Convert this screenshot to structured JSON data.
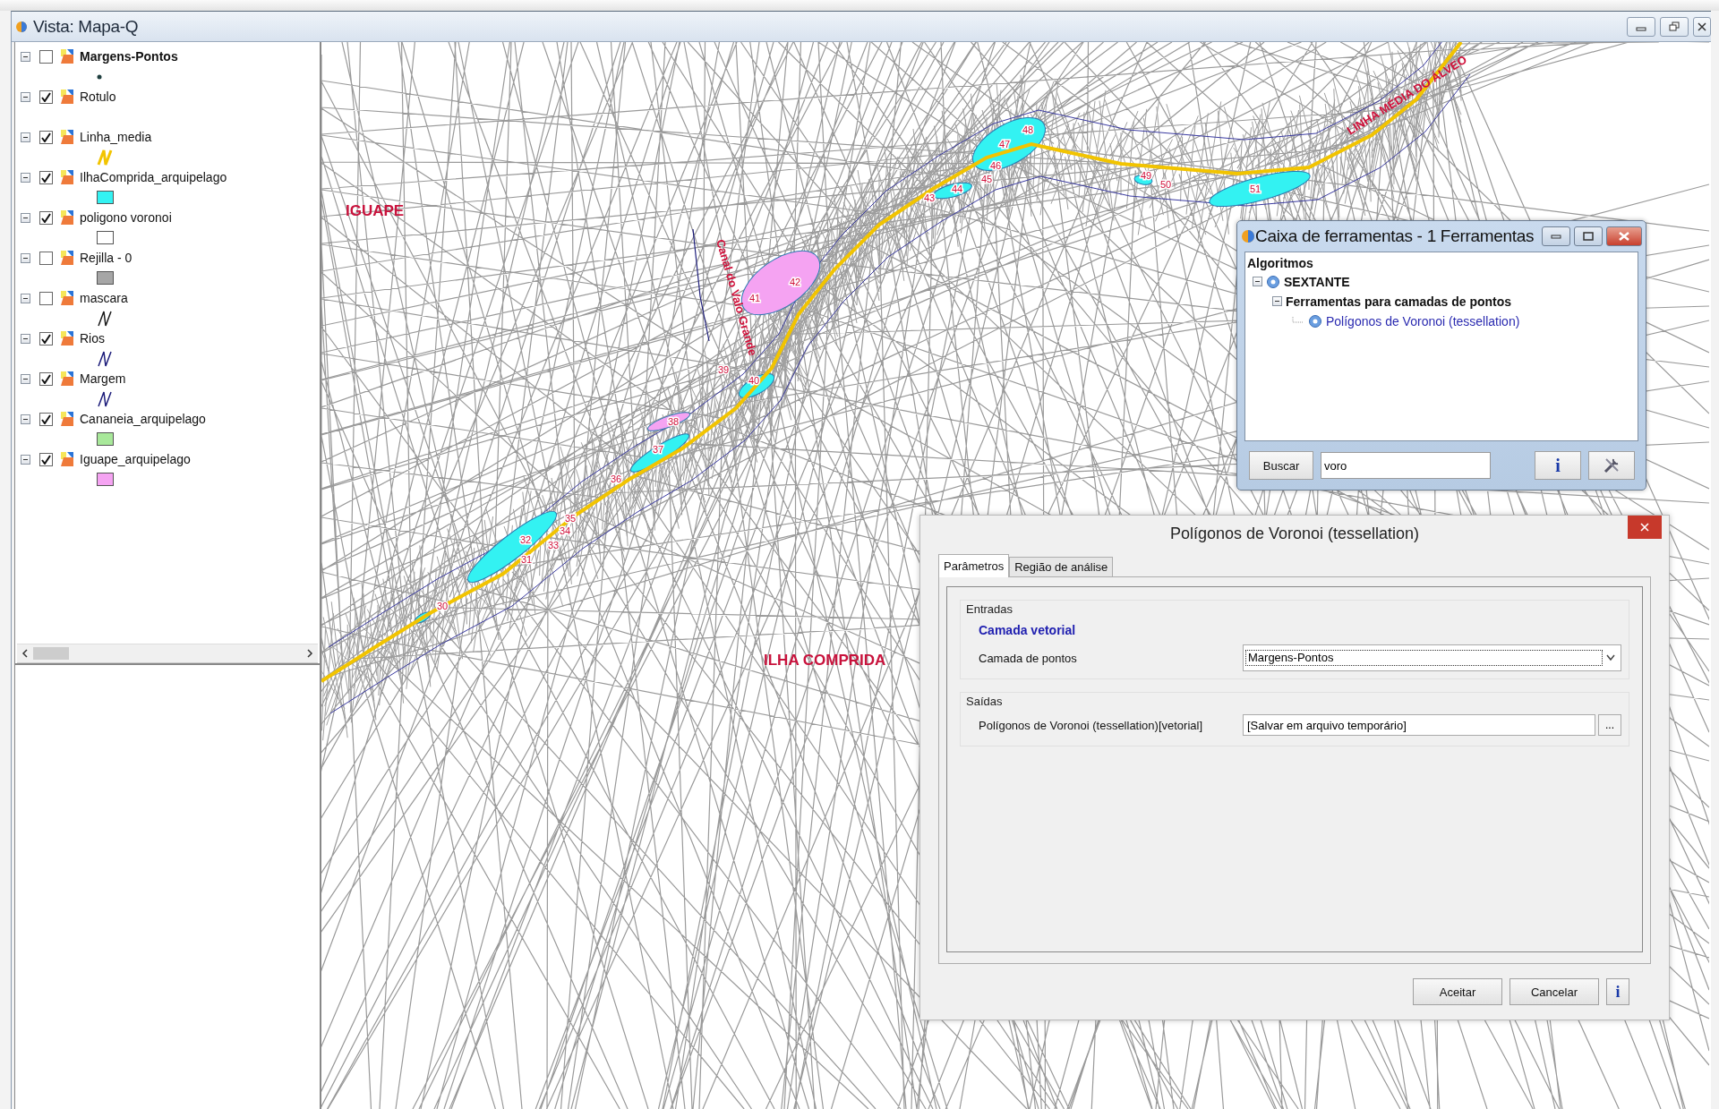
{
  "window": {
    "title": "Vista: Mapa-Q"
  },
  "layers": [
    {
      "name": "Margens-Pontos",
      "selected": true,
      "checked": false,
      "expanded": true,
      "legend": {
        "kind": "point",
        "color": "#1f3f3f"
      }
    },
    {
      "name": "Rotulo",
      "selected": false,
      "checked": true,
      "expanded": true
    },
    {
      "name": "Linha_media",
      "selected": false,
      "checked": true,
      "expanded": true,
      "legend": {
        "kind": "line",
        "color": "#f2c400"
      }
    },
    {
      "name": "IlhaComprida_arquipelago",
      "selected": false,
      "checked": true,
      "expanded": true,
      "legend": {
        "kind": "fill",
        "color": "#33f2f2"
      }
    },
    {
      "name": "poligono voronoi",
      "selected": false,
      "checked": true,
      "expanded": true,
      "legend": {
        "kind": "fill",
        "color": "#ffffff"
      }
    },
    {
      "name": "Rejilla - 0",
      "selected": false,
      "checked": false,
      "expanded": true,
      "legend": {
        "kind": "fill",
        "color": "#a6a6a6"
      }
    },
    {
      "name": "mascara",
      "selected": false,
      "checked": false,
      "expanded": true,
      "legend": {
        "kind": "line",
        "color": "#1a1a1a"
      }
    },
    {
      "name": "Rios",
      "selected": false,
      "checked": true,
      "expanded": true,
      "legend": {
        "kind": "line",
        "color": "#1c1c7a"
      }
    },
    {
      "name": "Margem",
      "selected": false,
      "checked": true,
      "expanded": true,
      "legend": {
        "kind": "line",
        "color": "#1c1c7a"
      }
    },
    {
      "name": "Cananeia_arquipelago",
      "selected": false,
      "checked": true,
      "expanded": true,
      "legend": {
        "kind": "fill",
        "color": "#a8e89a"
      }
    },
    {
      "name": "Iguape_arquipelago",
      "selected": false,
      "checked": true,
      "expanded": true,
      "legend": {
        "kind": "fill",
        "color": "#f5a3f2"
      }
    }
  ],
  "map": {
    "labels": [
      {
        "text": "48",
        "kind": "number"
      },
      {
        "text": "LINHA MÉDIA DO ÁLVEO",
        "kind": "feature"
      },
      {
        "text": "47",
        "kind": "number"
      },
      {
        "text": "46",
        "kind": "number"
      },
      {
        "text": "49",
        "kind": "number"
      },
      {
        "text": "45",
        "kind": "number"
      },
      {
        "text": "50",
        "kind": "number"
      },
      {
        "text": "44",
        "kind": "number"
      },
      {
        "text": "51",
        "kind": "number"
      },
      {
        "text": "43",
        "kind": "number"
      },
      {
        "text": "IGUAPE",
        "kind": "region"
      },
      {
        "text": "Canal do Valo Grande",
        "kind": "feature"
      },
      {
        "text": "42",
        "kind": "number"
      },
      {
        "text": "41",
        "kind": "number"
      },
      {
        "text": "39",
        "kind": "number"
      },
      {
        "text": "40",
        "kind": "number"
      },
      {
        "text": "38",
        "kind": "number"
      },
      {
        "text": "37",
        "kind": "number"
      },
      {
        "text": "36",
        "kind": "number"
      },
      {
        "text": "35",
        "kind": "number"
      },
      {
        "text": "34",
        "kind": "number"
      },
      {
        "text": "32",
        "kind": "number"
      },
      {
        "text": "33",
        "kind": "number"
      },
      {
        "text": "31",
        "kind": "number"
      },
      {
        "text": "30",
        "kind": "number"
      },
      {
        "text": "ILHA COMPRIDA",
        "kind": "region"
      }
    ]
  },
  "toolbox": {
    "title": "Caixa de ferramentas - 1 Ferramentas",
    "heading": "Algoritmos",
    "tree": [
      {
        "label": "SEXTANTE",
        "kind": "provider",
        "expanded": true,
        "children": [
          {
            "label": "Ferramentas para camadas de pontos",
            "kind": "group",
            "expanded": true,
            "children": [
              {
                "label": "Polígonos de Voronoi (tessellation)",
                "kind": "algorithm"
              }
            ]
          }
        ]
      }
    ],
    "search_button": "Buscar",
    "search_value": "voro",
    "info_button": "i"
  },
  "dialog": {
    "title": "Polígonos de Voronoi (tessellation)",
    "tabs": [
      {
        "label": "Parâmetros",
        "selected": true
      },
      {
        "label": "Região de análise",
        "selected": false
      }
    ],
    "groups": [
      {
        "title": "Entradas",
        "subheading": "Camada vetorial",
        "rows": [
          {
            "label": "Camada de pontos",
            "kind": "dropdown",
            "value": "Margens-Pontos"
          }
        ]
      },
      {
        "title": "Saídas",
        "rows": [
          {
            "label": "Polígonos de Voronoi (tessellation)[vetorial]",
            "kind": "file",
            "value": "[Salvar em arquivo temporário]",
            "button": "..."
          }
        ]
      }
    ],
    "buttons": [
      "Aceitar",
      "Cancelar"
    ],
    "info_button": "i"
  }
}
